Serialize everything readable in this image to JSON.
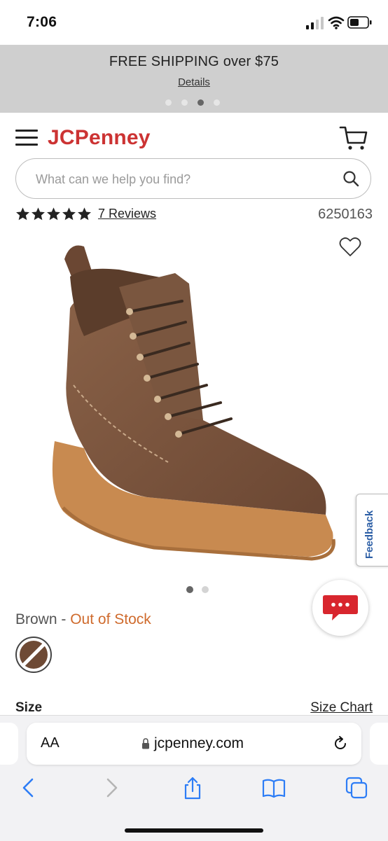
{
  "status_bar": {
    "time": "7:06"
  },
  "promo": {
    "title": "FREE SHIPPING over $75",
    "link": "Details",
    "slides": 4,
    "active_slide": 3
  },
  "header": {
    "logo": "JCPenney",
    "brand_color": "#cc3333"
  },
  "search": {
    "placeholder": "What can we help you find?",
    "value": ""
  },
  "product": {
    "rating": 5,
    "reviews_label": "7 Reviews",
    "product_id": "6250163",
    "image_count": 2,
    "active_image": 1,
    "color_label": "Brown",
    "separator": " - ",
    "stock_status": "Out of Stock",
    "size_label": "Size",
    "size_chart_label": "Size Chart"
  },
  "feedback": {
    "label": "Feedback"
  },
  "browser": {
    "aa_label": "AA",
    "url": "jcpenney.com"
  },
  "colors": {
    "accent_blue": "#2d7df6",
    "stock_orange": "#cf6a2c",
    "promo_bg": "#cfcfcf"
  },
  "icons": [
    "menu-icon",
    "cart-icon",
    "search-icon",
    "star-icon",
    "heart-icon",
    "chat-icon",
    "lock-icon",
    "reload-icon",
    "back-icon",
    "forward-icon",
    "share-icon",
    "bookmarks-icon",
    "tabs-icon"
  ]
}
